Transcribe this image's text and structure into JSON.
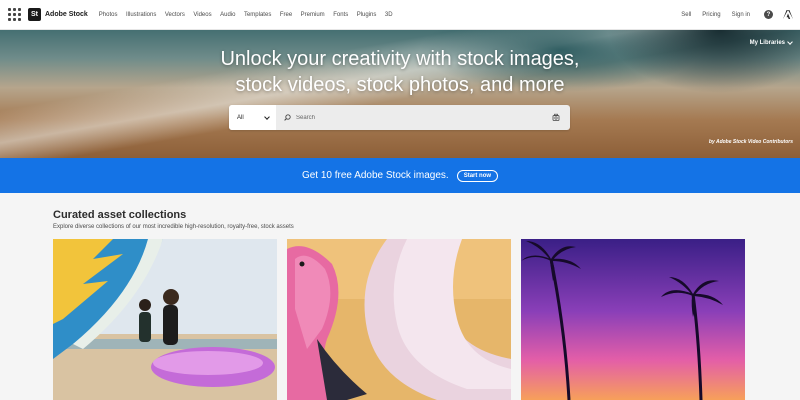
{
  "brand": {
    "mark": "St",
    "name": "Adobe Stock"
  },
  "nav": {
    "links": [
      "Photos",
      "Illustrations",
      "Vectors",
      "Videos",
      "Audio",
      "Templates",
      "Free",
      "Premium",
      "Fonts",
      "Plugins",
      "3D"
    ],
    "right": {
      "sell": "Sell",
      "pricing": "Pricing",
      "signin": "Sign in",
      "help": "?"
    }
  },
  "icons": {
    "apps": "apps-grid-icon",
    "help": "help-icon",
    "adobe": "adobe-logo-icon",
    "search": "search-icon",
    "visual_search": "camera-search-icon",
    "chevron": "chevron-down-icon"
  },
  "hero": {
    "title_line1": "Unlock your creativity with stock images,",
    "title_line2": "stock videos, stock photos, and more",
    "my_libraries": "My Libraries",
    "search": {
      "category": "All",
      "placeholder": "Search"
    },
    "credit": "by Adobe Stock Video Contributors"
  },
  "promo": {
    "text": "Get 10 free Adobe Stock images.",
    "button": "Start now"
  },
  "collections": {
    "title": "Curated asset collections",
    "subtitle": "Explore diverse collections of our most incredible high-resolution, royalty-free, stock assets"
  },
  "colors": {
    "accent": "#1473e6",
    "nav_bg": "#ffffff",
    "page_bg": "#f5f5f5"
  }
}
